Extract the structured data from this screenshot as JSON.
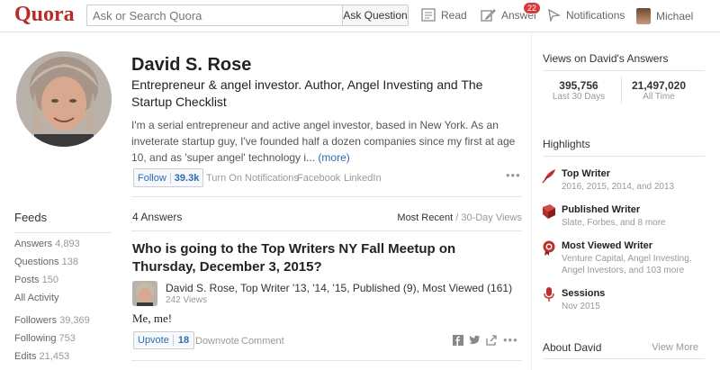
{
  "header": {
    "logo": "Quora",
    "search_placeholder": "Ask or Search Quora",
    "ask_button": "Ask Question",
    "nav": {
      "read": "Read",
      "answer": "Answer",
      "answer_badge": "22",
      "notifications": "Notifications",
      "user": "Michael"
    }
  },
  "profile": {
    "name": "David S. Rose",
    "tagline": "Entrepreneur & angel investor. Author, Angel Investing and The Startup Checklist",
    "bio": "I'm a serial entrepreneur and active angel investor, based in New York. As an inveterate startup guy, I've founded half a dozen companies since my first at age 10, and as 'super angel' technology i...",
    "bio_more": "(more)",
    "follow_label": "Follow",
    "follow_count": "39.3k",
    "links": [
      "Turn On Notifications",
      "Facebook",
      "LinkedIn"
    ]
  },
  "feeds": {
    "title": "Feeds",
    "items": [
      {
        "label": "Answers",
        "count": "4,893"
      },
      {
        "label": "Questions",
        "count": "138"
      },
      {
        "label": "Posts",
        "count": "150"
      },
      {
        "label": "All Activity",
        "count": ""
      },
      {
        "label": "Followers",
        "count": "39,369"
      },
      {
        "label": "Following",
        "count": "753"
      },
      {
        "label": "Edits",
        "count": "21,453"
      }
    ]
  },
  "answers": {
    "count_label": "4 Answers",
    "sort_active": "Most Recent",
    "sort_sep": " / ",
    "sort_alt": "30-Day Views",
    "question": "Who is going to the Top Writers NY Fall Meetup on Thursday, December 3, 2015?",
    "author_line": "David S. Rose, Top Writer '13, '14, '15, Published (9), Most Viewed (161)",
    "views": "242 Views",
    "text": "Me, me!",
    "upvote_label": "Upvote",
    "upvote_count": "18",
    "downvote": "Downvote",
    "comment": "Comment"
  },
  "sidebar": {
    "views_title": "Views on David's Answers",
    "stats": [
      {
        "value": "395,756",
        "label": "Last 30 Days"
      },
      {
        "value": "21,497,020",
        "label": "All Time"
      }
    ],
    "highlights_title": "Highlights",
    "highlights": [
      {
        "title": "Top Writer",
        "sub": "2016, 2015, 2014, and 2013",
        "icon": "quill-icon"
      },
      {
        "title": "Published Writer",
        "sub": "Slate, Forbes, and 8 more",
        "icon": "book-icon"
      },
      {
        "title": "Most Viewed Writer",
        "sub": "Venture Capital, Angel Investing, Angel Investors, and 103 more",
        "icon": "medal-icon"
      },
      {
        "title": "Sessions",
        "sub": "Nov 2015",
        "icon": "microphone-icon"
      }
    ],
    "about_title": "About David",
    "view_more": "View More"
  },
  "colors": {
    "brand": "#b92b27",
    "link": "#2b6dad",
    "badge": "#d9383a"
  }
}
